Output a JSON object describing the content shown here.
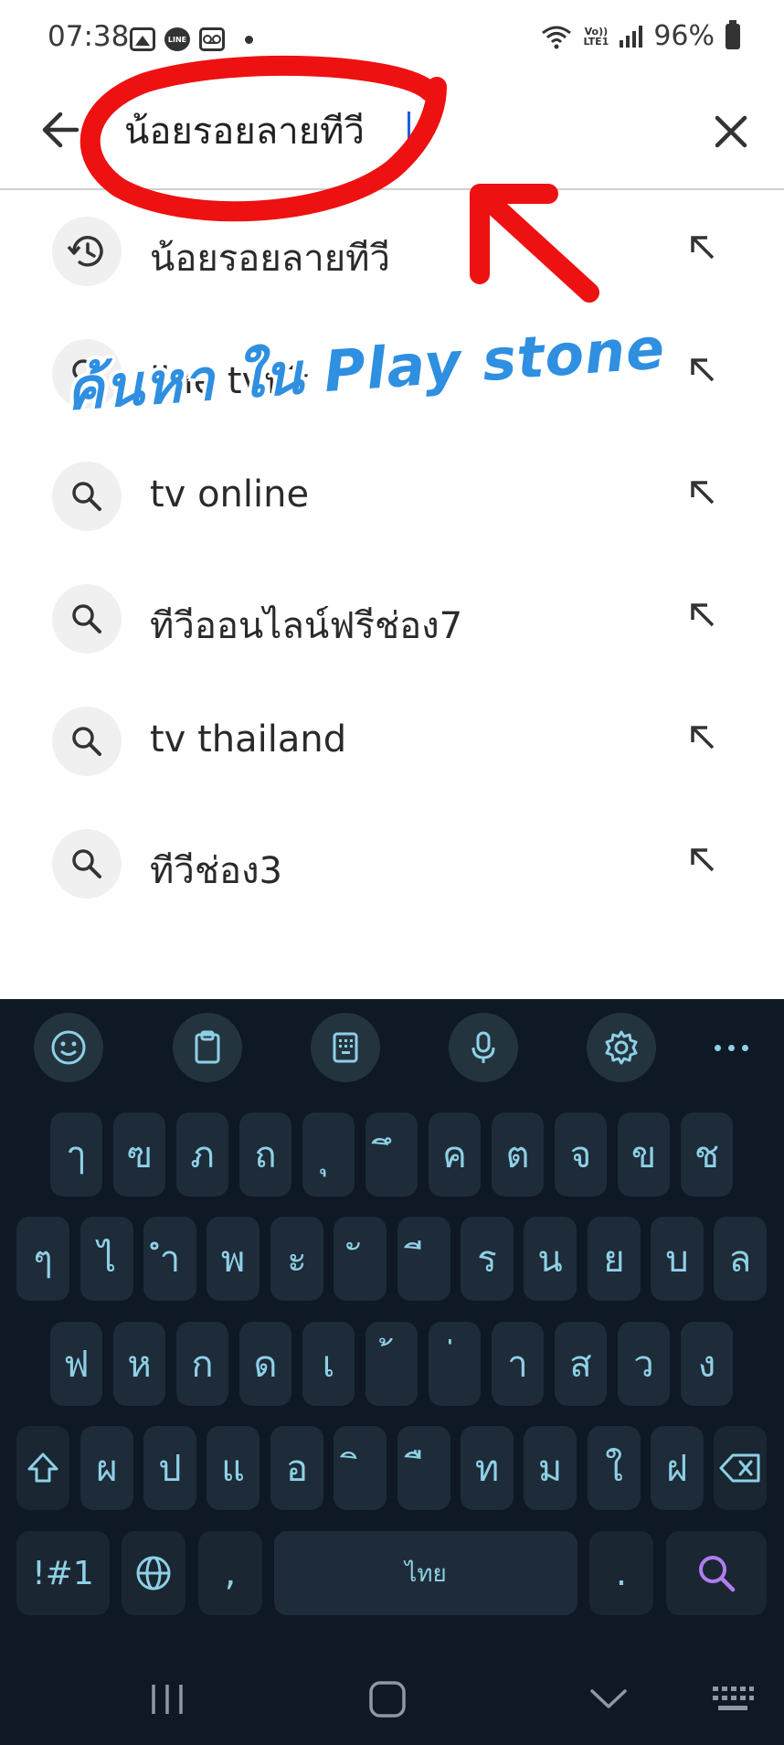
{
  "status_bar": {
    "time": "07:38",
    "line_label": "LINE",
    "volte_top": "Vo))",
    "volte_bottom": "LTE1",
    "battery": "96%"
  },
  "search": {
    "query": "น้อยรอยลายทีวี"
  },
  "suggestions": [
    {
      "text": "น้อยรอยลายทีวี",
      "icon": "history-icon"
    },
    {
      "text": "line tvฟรี",
      "icon": "search-icon"
    },
    {
      "text": "tv online",
      "icon": "search-icon"
    },
    {
      "text": "ทีวีออนไลน์ฟรีช่อง7",
      "icon": "search-icon"
    },
    {
      "text": "tv thailand",
      "icon": "search-icon"
    },
    {
      "text": "ทีวีช่อง3",
      "icon": "search-icon"
    }
  ],
  "annotation": {
    "text": "ค้นหา ใน Play stone",
    "color": "#2f8fe0",
    "marker_color": "#ee1111"
  },
  "keyboard": {
    "theme_bg": "#0f1825",
    "key_color": "#8ed0e6",
    "toolbar": [
      "emoji-icon",
      "clipboard-icon",
      "keypad-icon",
      "mic-icon",
      "settings-icon",
      "more-icon"
    ],
    "rows": [
      [
        "ๅ",
        "ฃ",
        "ภ",
        "ถ",
        "ุ",
        "ึ",
        "ค",
        "ต",
        "จ",
        "ข",
        "ช"
      ],
      [
        "ๆ",
        "ไ",
        "ำ",
        "พ",
        "ะ",
        "ั",
        "ี",
        "ร",
        "น",
        "ย",
        "บ",
        "ล"
      ],
      [
        "ฟ",
        "ห",
        "ก",
        "ด",
        "เ",
        "้",
        "่",
        "า",
        "ส",
        "ว",
        "ง"
      ],
      [
        "ผ",
        "ป",
        "แ",
        "อ",
        "ิ",
        "ื",
        "ท",
        "ม",
        "ใ",
        "ฝ"
      ]
    ],
    "symbols_label": "!#1",
    "comma_label": ",",
    "space_label": "ไทย",
    "period_label": "."
  }
}
